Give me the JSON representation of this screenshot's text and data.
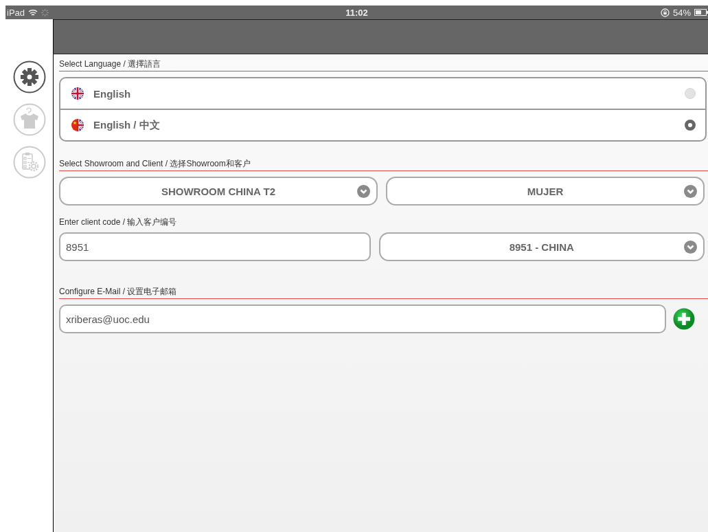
{
  "status_bar": {
    "device": "iPad",
    "time": "11:02",
    "battery": "54%"
  },
  "sidebar": {
    "items": [
      {
        "kind": "settings",
        "selected": true
      },
      {
        "kind": "shirt",
        "selected": false
      },
      {
        "kind": "checklist",
        "selected": false
      }
    ]
  },
  "language": {
    "heading": "Select Language / 選擇語言",
    "options": [
      {
        "label": "English",
        "kind": "uk",
        "selected": false
      },
      {
        "label": "English / 中文",
        "kind": "bilingual",
        "selected": true
      }
    ]
  },
  "showroom": {
    "heading": "Select Showroom and Client / 选择Showroom和客户",
    "showroom_select": "SHOWROOM CHINA T2",
    "client_select": "MUJER"
  },
  "client_code": {
    "heading": "Enter client code / 输入客户编号",
    "value": "8951",
    "client_select": "8951 - CHINA"
  },
  "email": {
    "heading": "Configure E-Mail / 设置电子邮箱",
    "value": "xriberas@uoc.edu"
  }
}
